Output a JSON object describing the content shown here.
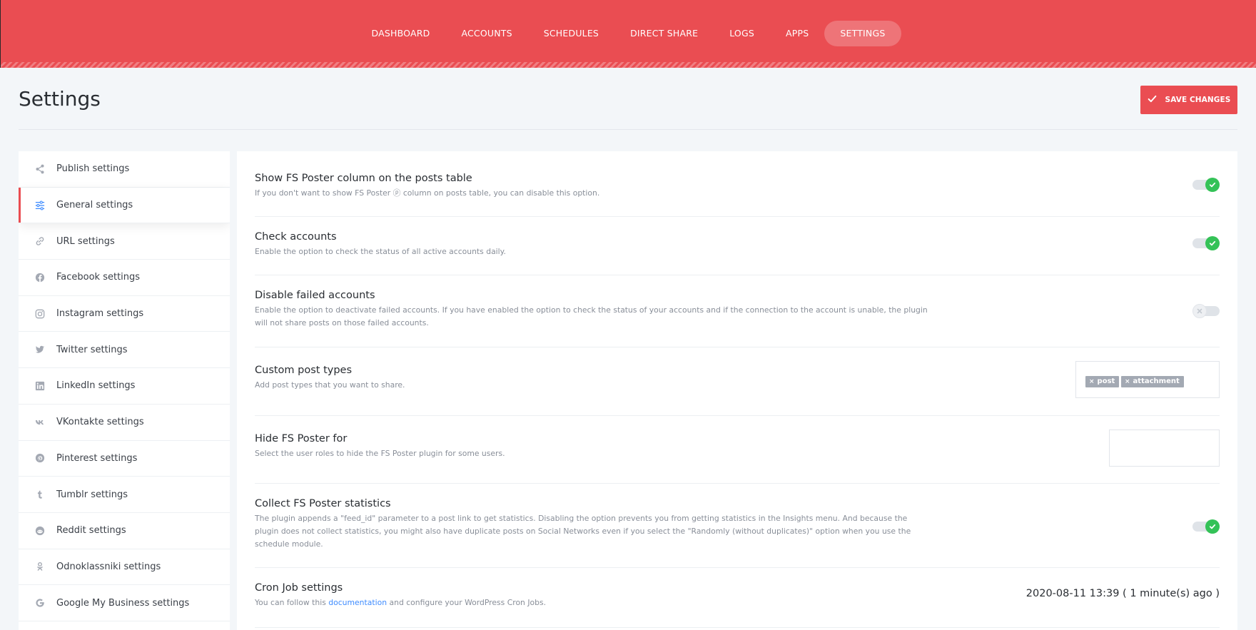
{
  "nav": {
    "items": [
      {
        "label": "DASHBOARD"
      },
      {
        "label": "ACCOUNTS"
      },
      {
        "label": "SCHEDULES"
      },
      {
        "label": "DIRECT SHARE"
      },
      {
        "label": "LOGS"
      },
      {
        "label": "APPS"
      },
      {
        "label": "SETTINGS",
        "active": true
      }
    ]
  },
  "header": {
    "title": "Settings",
    "save_label": "SAVE CHANGES"
  },
  "sidebar": {
    "items": [
      {
        "label": "Publish settings",
        "icon": "share-icon"
      },
      {
        "label": "General settings",
        "icon": "sliders-icon",
        "active": true
      },
      {
        "label": "URL settings",
        "icon": "link-icon"
      },
      {
        "label": "Facebook settings",
        "icon": "facebook-icon"
      },
      {
        "label": "Instagram settings",
        "icon": "instagram-icon"
      },
      {
        "label": "Twitter settings",
        "icon": "twitter-icon"
      },
      {
        "label": "LinkedIn settings",
        "icon": "linkedin-icon"
      },
      {
        "label": "VKontakte settings",
        "icon": "vk-icon"
      },
      {
        "label": "Pinterest settings",
        "icon": "pinterest-icon"
      },
      {
        "label": "Tumblr settings",
        "icon": "tumblr-icon"
      },
      {
        "label": "Reddit settings",
        "icon": "reddit-icon"
      },
      {
        "label": "Odnoklassniki settings",
        "icon": "odnoklassniki-icon"
      },
      {
        "label": "Google My Business settings",
        "icon": "google-icon"
      }
    ]
  },
  "settings": {
    "show_column": {
      "title": "Show FS Poster column on the posts table",
      "desc": "If you don't want to show FS Poster ⓟ column on posts table, you can disable this option.",
      "enabled": true
    },
    "check_accounts": {
      "title": "Check accounts",
      "desc": "Enable the option to check the status of all active accounts daily.",
      "enabled": true
    },
    "disable_failed": {
      "title": "Disable failed accounts",
      "desc": "Enable the option to deactivate failed accounts. If you have enabled the option to check the status of your accounts and if the connection to the account is unable, the plugin will not share posts on those failed accounts.",
      "enabled": false
    },
    "custom_post_types": {
      "title": "Custom post types",
      "desc": "Add post types that you want to share.",
      "tags": [
        "post",
        "attachment"
      ],
      "tag_remove": "×"
    },
    "hide_for": {
      "title": "Hide FS Poster for",
      "desc": "Select the user roles to hide the FS Poster plugin for some users."
    },
    "collect_stats": {
      "title": "Collect FS Poster statistics",
      "desc": "The plugin appends a \"feed_id\" parameter to a post link to get statistics. Disabling the option prevents you from getting statistics in the Insights menu. And because the plugin does not collect statistics, you might also have duplicate posts on Social Networks even if you select the \"Randomly (without duplicates)\" option when you use the schedule module.",
      "enabled": true
    },
    "cron": {
      "title": "Cron Job settings",
      "desc_before": "You can follow this ",
      "desc_link": "documentation",
      "desc_after": " and configure your WordPress Cron Jobs.",
      "value": "2020-08-11 13:39 ( 1 minute(s) ago )"
    }
  },
  "colors": {
    "brand": "#ea4d52",
    "toggle_on": "#34c257",
    "link": "#3f8cff"
  }
}
